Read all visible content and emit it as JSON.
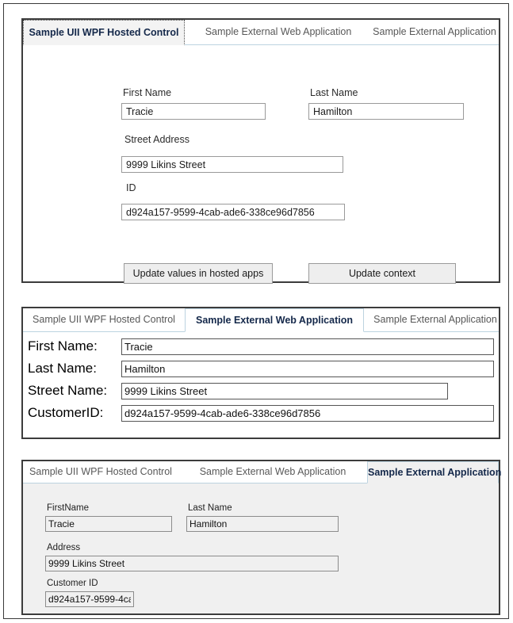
{
  "tabs": {
    "wpf": "Sample UII WPF Hosted Control",
    "web": "Sample External Web Application",
    "ext": "Sample External Application"
  },
  "colors": {
    "active_tab_text": "#14284a",
    "inactive_tab_text": "#585858",
    "panel_border": "#3c3c3c",
    "tab_underline": "#bcd3e0",
    "ext_panel_bg": "#f0f0f0",
    "button_bg": "#eeeeee"
  },
  "panel_wpf": {
    "active_tab": "Sample UII WPF Hosted Control",
    "labels": {
      "first_name": "First Name",
      "last_name": "Last Name",
      "street_address": "Street Address",
      "id": "ID"
    },
    "values": {
      "first_name": "Tracie",
      "last_name": "Hamilton",
      "street_address": "9999 Likins Street",
      "id": "d924a157-9599-4cab-ade6-338ce96d7856"
    },
    "buttons": {
      "update_values": "Update values in hosted apps",
      "update_context": "Update context"
    }
  },
  "panel_web": {
    "active_tab": "Sample External Web Application",
    "rows": [
      {
        "label": "First Name:",
        "value": "Tracie"
      },
      {
        "label": "Last Name:",
        "value": "Hamilton"
      },
      {
        "label": "Street Name:",
        "value": "9999 Likins Street"
      },
      {
        "label": "CustomerID:",
        "value": "d924a157-9599-4cab-ade6-338ce96d7856"
      }
    ]
  },
  "panel_ext": {
    "active_tab": "Sample External Application",
    "labels": {
      "first_name": "FirstName",
      "last_name": "Last Name",
      "address": "Address",
      "customer_id": "Customer ID"
    },
    "values": {
      "first_name": "Tracie",
      "last_name": "Hamilton",
      "address": "9999 Likins Street",
      "customer_id": "d924a157-9599-4ca"
    }
  }
}
